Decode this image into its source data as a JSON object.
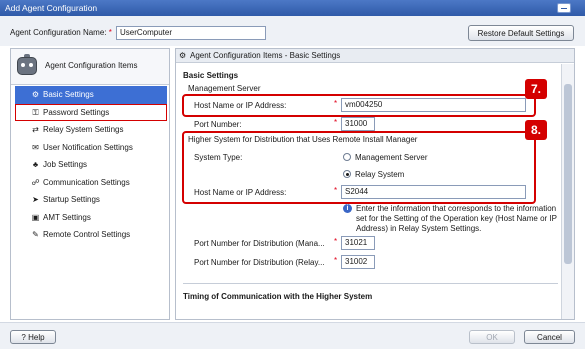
{
  "window": {
    "title": "Add Agent Configuration"
  },
  "top": {
    "config_name_label": "Agent Configuration Name:",
    "required_mark": "*",
    "config_name_value": "UserComputer",
    "restore_button": "Restore Default Settings"
  },
  "sidebar": {
    "title": "Agent Configuration Items",
    "items": [
      {
        "label": "Basic Settings",
        "icon": "basic-settings-icon"
      },
      {
        "label": "Password Settings",
        "icon": "password-icon"
      },
      {
        "label": "Relay System Settings",
        "icon": "relay-system-icon"
      },
      {
        "label": "User Notification Settings",
        "icon": "user-notification-icon"
      },
      {
        "label": "Job Settings",
        "icon": "job-icon"
      },
      {
        "label": "Communication Settings",
        "icon": "communication-icon"
      },
      {
        "label": "Startup Settings",
        "icon": "startup-icon"
      },
      {
        "label": "AMT Settings",
        "icon": "amt-icon"
      },
      {
        "label": "Remote Control Settings",
        "icon": "remote-control-icon"
      }
    ]
  },
  "panel": {
    "header": "Agent Configuration Items - Basic Settings",
    "section_title": "Basic Settings",
    "management_server": {
      "group_label": "Management Server",
      "host_label": "Host Name or IP Address:",
      "host_value": "vm004250",
      "port_label": "Port Number:",
      "port_value": "31000"
    },
    "higher_system": {
      "group_label": "Higher System for Distribution that Uses Remote Install Manager",
      "system_type_label": "System Type:",
      "option_management": "Management Server",
      "option_relay": "Relay System",
      "selected": "Relay System",
      "host_label": "Host Name or IP Address:",
      "host_value": "S2044"
    },
    "info_text": "Enter the information that corresponds to the information set for the Setting of the Operation key (Host Name or IP Address) in Relay System Settings.",
    "dist_port_mana_label": "Port Number for Distribution (Mana...",
    "dist_port_mana_value": "31021",
    "dist_port_relay_label": "Port Number for Distribution (Relay...",
    "dist_port_relay_value": "31002",
    "timing_title": "Timing of Communication with the Higher System"
  },
  "markers": {
    "m7": "7.",
    "m8": "8."
  },
  "footer": {
    "help": "Help",
    "ok": "OK",
    "cancel": "Cancel"
  },
  "colors": {
    "accent": "#3d6fd4",
    "callout": "#d40000",
    "title_bar": "#2f5aa8",
    "required": "#e0001a"
  }
}
